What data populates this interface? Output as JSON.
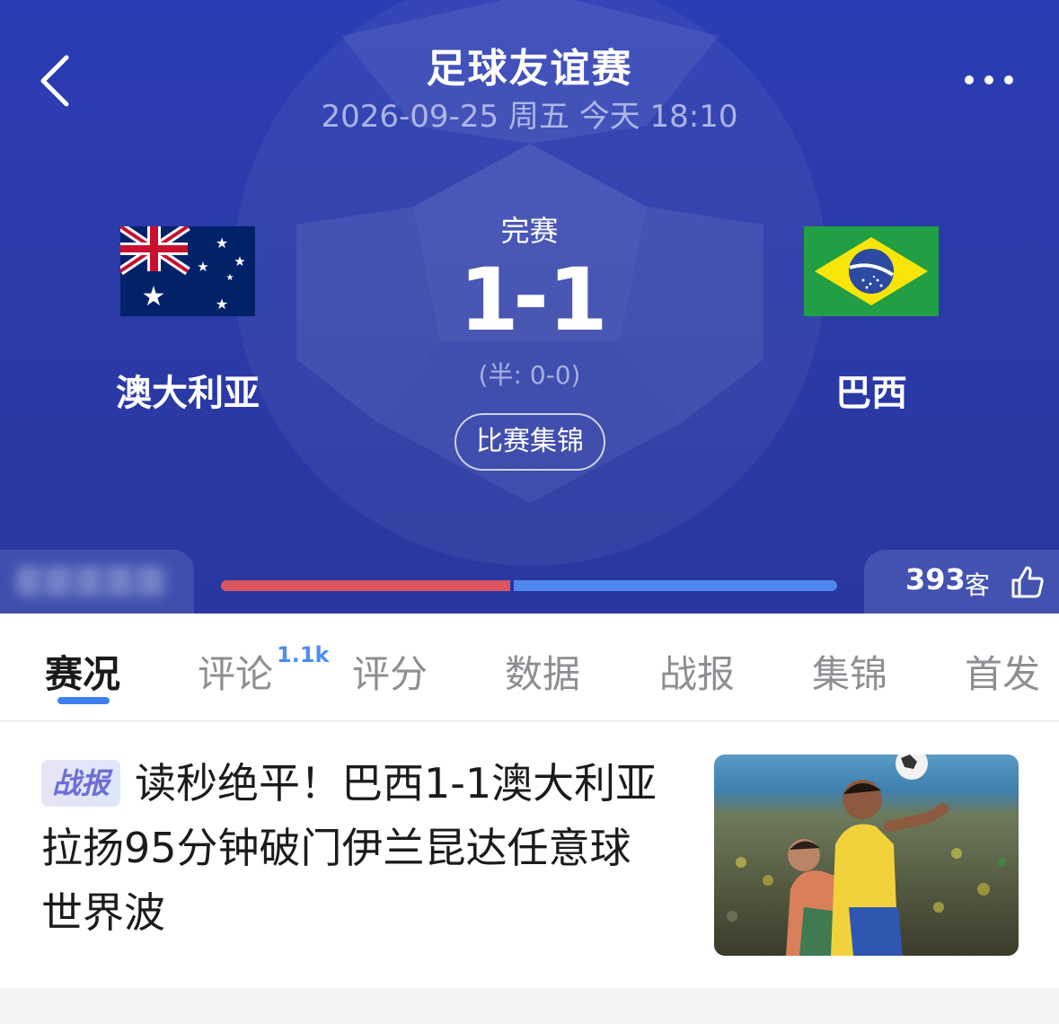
{
  "header": {
    "title": "足球友谊赛",
    "datetime": "2026-09-25 周五 今天 18:10",
    "status": "完赛",
    "halftime": "(半: 0-0)",
    "highlights_button": "比赛集锦",
    "colors": {
      "background": "#2a3aa8",
      "home_bar": "#d9545e",
      "away_bar": "#4f86ef"
    }
  },
  "match": {
    "home": {
      "name": "澳大利亚",
      "score": "1",
      "flag_icon": "australia-flag"
    },
    "away": {
      "name": "巴西",
      "score": "1",
      "flag_icon": "brazil-flag"
    },
    "separator": "-",
    "support_bar": {
      "home_fraction": 0.47,
      "away_fraction": 0.53
    }
  },
  "likes": {
    "count": "393",
    "unit": "客"
  },
  "tabs": [
    {
      "label": "赛况",
      "active": true
    },
    {
      "label": "评论",
      "badge": "1.1k"
    },
    {
      "label": "评分"
    },
    {
      "label": "数据"
    },
    {
      "label": "战报"
    },
    {
      "label": "集锦"
    },
    {
      "label": "首发"
    }
  ],
  "article": {
    "badge": "战报",
    "title": "读秒绝平！巴西1-1澳大利亚 拉扬95分钟破门伊兰昆达任意球世界波",
    "thumbnail_icon": "match-photo"
  }
}
